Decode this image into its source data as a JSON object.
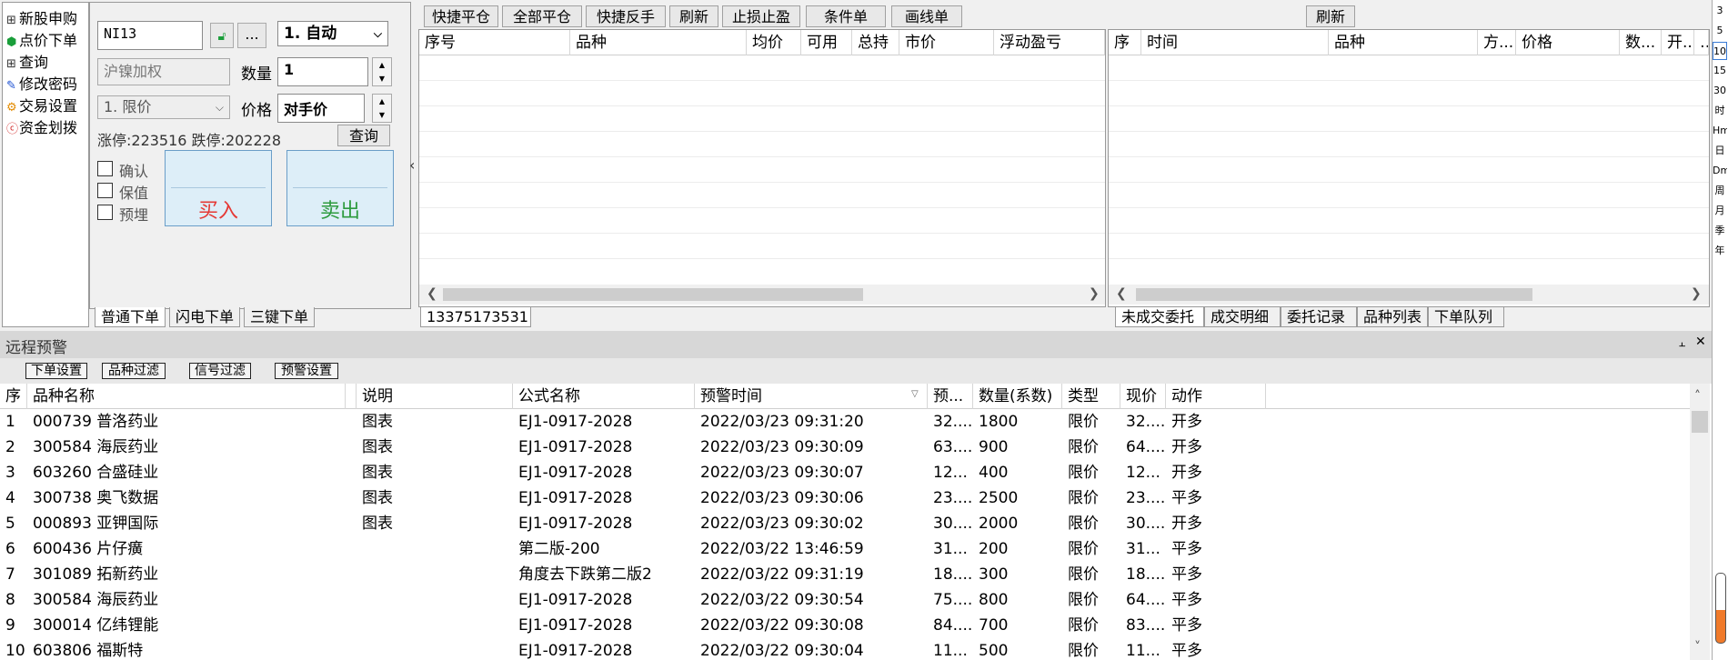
{
  "left_menu": {
    "items": [
      {
        "icon": "plus-box-icon",
        "label": "新股申购"
      },
      {
        "icon": "green-dot-icon",
        "label": "点价下单"
      },
      {
        "icon": "plus-box-icon",
        "label": "查询"
      },
      {
        "icon": "edit-icon",
        "label": "修改密码"
      },
      {
        "icon": "gear-icon",
        "label": "交易设置"
      },
      {
        "icon": "money-icon",
        "label": "资金划拨"
      }
    ]
  },
  "order_panel": {
    "account_code": "NI13",
    "more_label": "...",
    "mode_select": "1. 自动",
    "contract_name": "沪镍加权",
    "quantity_label": "数量",
    "quantity_value": "1",
    "order_type_select": "1. 限价",
    "price_label": "价格",
    "price_value": "对手价",
    "limit_text": "涨停:223516 跌停:202228",
    "query_button": "查询",
    "confirm_label": "确认",
    "hedge_label": "保值",
    "preset_label": "预埋",
    "buy_label": "买入",
    "sell_label": "卖出",
    "tabs": [
      "普通下单",
      "闪电下单",
      "三键下单"
    ]
  },
  "toolbar": {
    "buttons": [
      "快捷平仓",
      "全部平仓",
      "快捷反手",
      "刷新",
      "止损止盈",
      "条件单",
      "画线单"
    ],
    "right_refresh": "刷新"
  },
  "position_table": {
    "headers": [
      "序号",
      "品种",
      "均价",
      "可用",
      "总持",
      "市价",
      "浮动盈亏"
    ],
    "account_tab": "13375173531"
  },
  "order_table": {
    "headers": [
      "序",
      "时间",
      "品种",
      "方...",
      "价格",
      "数...",
      "开...",
      "…"
    ],
    "tabs": [
      "未成交委托",
      "成交明细",
      "委托记录",
      "品种列表",
      "下单队列"
    ]
  },
  "right_strip": {
    "items": [
      "3",
      "5",
      "10",
      "15",
      "30",
      "时",
      "Hm",
      "日",
      "Dm",
      "周",
      "月",
      "季",
      "年"
    ]
  },
  "alert_panel": {
    "title": "远程预警",
    "buttons": [
      "下单设置",
      "品种过滤",
      "信号过滤",
      "预警设置"
    ],
    "headers": [
      "序",
      "品种名称",
      "",
      "说明",
      "公式名称",
      "预警时间",
      "预...",
      "数量(系数)",
      "类型",
      "现价",
      "动作"
    ],
    "rows": [
      [
        "1",
        "000739 普洛药业",
        "",
        "图表",
        "EJ1-0917-2028",
        "2022/03/23 09:31:20",
        "32....",
        "1800",
        "限价",
        "32....",
        "开多"
      ],
      [
        "2",
        "300584 海辰药业",
        "",
        "图表",
        "EJ1-0917-2028",
        "2022/03/23 09:30:09",
        "63....",
        "900",
        "限价",
        "64....",
        "开多"
      ],
      [
        "3",
        "603260 合盛硅业",
        "",
        "图表",
        "EJ1-0917-2028",
        "2022/03/23 09:30:07",
        "12...",
        "400",
        "限价",
        "12...",
        "开多"
      ],
      [
        "4",
        "300738 奥飞数据",
        "",
        "图表",
        "EJ1-0917-2028",
        "2022/03/23 09:30:06",
        "23....",
        "2500",
        "限价",
        "23....",
        "平多"
      ],
      [
        "5",
        "000893 亚钾国际",
        "",
        "图表",
        "EJ1-0917-2028",
        "2022/03/23 09:30:02",
        "30....",
        "2000",
        "限价",
        "30....",
        "开多"
      ],
      [
        "6",
        "600436 片仔癀",
        "",
        "",
        "第二版-200",
        "2022/03/22 13:46:59",
        "31...",
        "200",
        "限价",
        "31...",
        "平多"
      ],
      [
        "7",
        "301089 拓新药业",
        "",
        "",
        "角度去下跌第二版2",
        "2022/03/22 09:31:19",
        "18....",
        "300",
        "限价",
        "18....",
        "平多"
      ],
      [
        "8",
        "300584 海辰药业",
        "",
        "",
        "EJ1-0917-2028",
        "2022/03/22 09:30:54",
        "75....",
        "800",
        "限价",
        "64....",
        "平多"
      ],
      [
        "9",
        "300014 亿纬锂能",
        "",
        "",
        "EJ1-0917-2028",
        "2022/03/22 09:30:08",
        "84....",
        "700",
        "限价",
        "83....",
        "平多"
      ],
      [
        "10",
        "603806 福斯特",
        "",
        "",
        "EJ1-0917-2028",
        "2022/03/22 09:30:04",
        "11...",
        "500",
        "限价",
        "11...",
        "平多"
      ]
    ]
  },
  "colors": {
    "buy": "#e53935",
    "sell": "#2e9b3f",
    "buy_bg": "#ddeef8"
  }
}
